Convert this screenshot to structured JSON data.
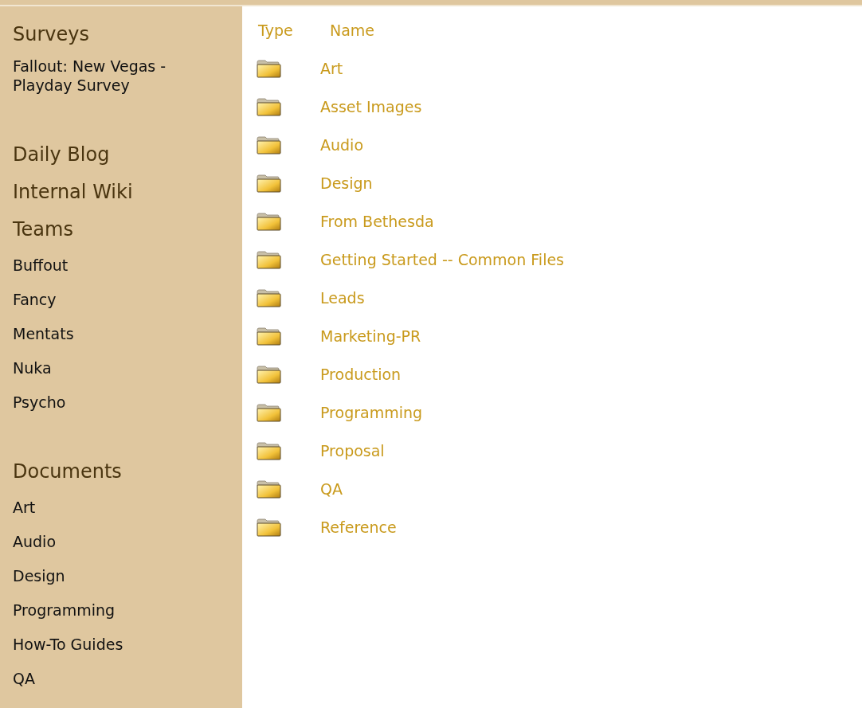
{
  "sidebar": {
    "groups": [
      {
        "items": [
          {
            "kind": "heading",
            "label": "Surveys"
          },
          {
            "kind": "link",
            "label": "Fallout: New Vegas - Playday Survey"
          }
        ]
      },
      {
        "items": [
          {
            "kind": "heading",
            "label": "Daily Blog"
          },
          {
            "kind": "heading",
            "label": "Internal Wiki"
          },
          {
            "kind": "heading",
            "label": "Teams"
          },
          {
            "kind": "link",
            "label": "Buffout"
          },
          {
            "kind": "link",
            "label": "Fancy"
          },
          {
            "kind": "link",
            "label": "Mentats"
          },
          {
            "kind": "link",
            "label": "Nuka"
          },
          {
            "kind": "link",
            "label": "Psycho"
          }
        ]
      },
      {
        "items": [
          {
            "kind": "heading",
            "label": "Documents"
          },
          {
            "kind": "link",
            "label": "Art"
          },
          {
            "kind": "link",
            "label": "Audio"
          },
          {
            "kind": "link",
            "label": "Design"
          },
          {
            "kind": "link",
            "label": "Programming"
          },
          {
            "kind": "link",
            "label": "How-To Guides"
          },
          {
            "kind": "link",
            "label": "QA"
          }
        ]
      }
    ]
  },
  "table": {
    "columns": [
      "Type",
      "Name"
    ],
    "rows": [
      {
        "name": "Art"
      },
      {
        "name": "Asset Images"
      },
      {
        "name": "Audio"
      },
      {
        "name": "Design"
      },
      {
        "name": "From Bethesda"
      },
      {
        "name": "Getting Started -- Common Files"
      },
      {
        "name": "Leads"
      },
      {
        "name": "Marketing-PR"
      },
      {
        "name": "Production"
      },
      {
        "name": "Programming"
      },
      {
        "name": "Proposal"
      },
      {
        "name": "QA"
      },
      {
        "name": "Reference"
      }
    ]
  }
}
